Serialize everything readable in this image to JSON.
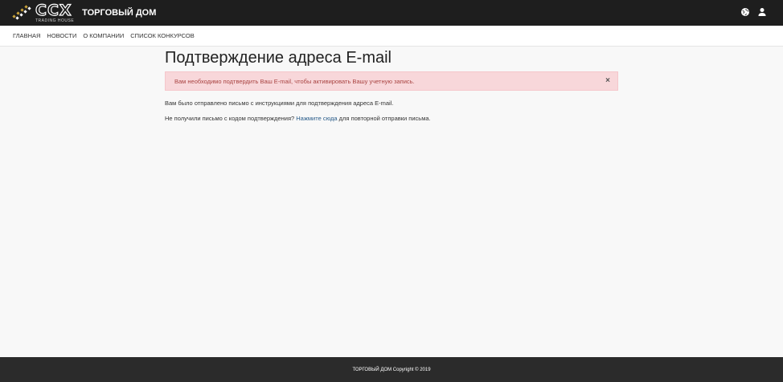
{
  "header": {
    "logo_main": "CCX",
    "logo_sub": "TRADING HOUSE",
    "brand": "ТОРГОВЫЙ ДОМ",
    "icons": [
      "globe-icon",
      "user-icon"
    ]
  },
  "nav": {
    "items": [
      {
        "label": "ГЛАВНАЯ"
      },
      {
        "label": "НОВОСТИ"
      },
      {
        "label": "О КОМПАНИИ"
      },
      {
        "label": "СПИСОК КОНКУРСОВ"
      }
    ]
  },
  "main": {
    "title": "Подтверждение адреса E-mail",
    "alert": {
      "text": "Вам необходимо подтвердить Ваш E-mail, чтобы активировать Вашу учетную запись.",
      "close": "×",
      "color": "#f8d7da"
    },
    "message1": "Вам было отправлено письмо с инструкциями для подтверждения адреса E-mail.",
    "message2_before": "Не получили письмо с кодом подтверждения? ",
    "message2_link": "Нажмите сюда",
    "message2_after": " для повторной отправки письма."
  },
  "footer": {
    "text": "ТОРГОВЫЙ ДОМ Copyright © 2019"
  }
}
